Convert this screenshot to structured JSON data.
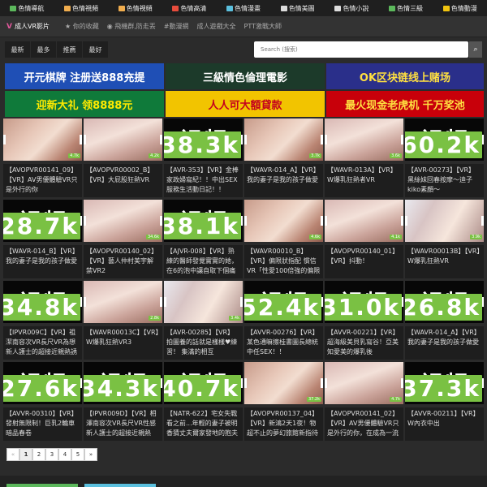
{
  "topnav": [
    {
      "label": "色情導航",
      "icon": "green-square-icon",
      "color": "#5cb85c"
    },
    {
      "label": "色情視頻",
      "icon": "orange-circle-icon",
      "color": "#f0ad4e"
    },
    {
      "label": "色情視頻",
      "icon": "orange-circle-icon",
      "color": "#f0ad4e"
    },
    {
      "label": "色情高清",
      "icon": "red-heart-icon",
      "color": "#e74c3c"
    },
    {
      "label": "色情漫畫",
      "icon": "blue-image-icon",
      "color": "#5bc0de"
    },
    {
      "label": "色情美圖",
      "icon": "picture-icon",
      "color": "#dddddd"
    },
    {
      "label": "色情小說",
      "icon": "book-icon",
      "color": "#dddddd"
    },
    {
      "label": "色情三級",
      "icon": "green-square-icon",
      "color": "#5cb85c"
    },
    {
      "label": "色情動漫",
      "icon": "yellow-circle-icon",
      "color": "#f1c40f"
    }
  ],
  "header": {
    "logo": "成人VR影片",
    "links": [
      "你的收藏",
      "飛機群,防走丟",
      "#動漫網",
      "成人遊戲大全",
      "PTT激戰大師"
    ]
  },
  "subnav": {
    "tabs": [
      "最新",
      "最多",
      "推薦",
      "最好"
    ],
    "search_placeholder": "Search (搜索)"
  },
  "banners": [
    {
      "text": "开元棋牌 注册送888充提",
      "bg": "#1f4fb5",
      "fg": "#ffffff"
    },
    {
      "text": "三級情色倫理電影",
      "bg": "#1c3a2a",
      "fg": "#ffffff"
    },
    {
      "text": "OK区块链线上赌场",
      "bg": "#2a2f8a",
      "fg": "#ffe040"
    },
    {
      "text": "迎新大礼 领8888元",
      "bg": "#0f7a3a",
      "fg": "#ffea00"
    },
    {
      "text": "人人可大額貸款",
      "bg": "#f2c400",
      "fg": "#c4001d"
    },
    {
      "text": "最火现金老虎机 千万奖池",
      "bg": "#c8000a",
      "fg": "#ffe040"
    }
  ],
  "cards": [
    {
      "type": "img",
      "badge": "4.7k",
      "title": "【AVOPVR00141_09】【VR】AV男優體驗VR只是外行的你"
    },
    {
      "type": "img",
      "badge": "4.2k",
      "title": "【AVOPVR00002_B】【VR】大屁股狂熱VR"
    },
    {
      "type": "video",
      "badge": "38.3k",
      "title": "【AVR-353】【VR】金棒家政婦寫紀！！中出SEX服務生活動日記！！"
    },
    {
      "type": "img",
      "badge": "3.7k",
      "title": "【WAVR-014_A】【VR】我的妻子是我的孩子做愛"
    },
    {
      "type": "img",
      "badge": "3.6k",
      "title": "【WAVR-013A】【VR】W爆乳狂熱者VR"
    },
    {
      "type": "video",
      "badge": "60.2k",
      "title": "【AVR-00273】【VR】黑絲妹回春按摩～迪子kiko素顏～"
    },
    {
      "type": "video",
      "badge": "28.7k",
      "title": "【WAVR-014_B】【VR】我的妻子是我的孩子做愛"
    },
    {
      "type": "img",
      "badge": "34.6k",
      "title": "【AVOPVR00140_02】【VR】藝人仲村美宇解禁VR2"
    },
    {
      "type": "video",
      "badge": "38.1k",
      "title": "【AJVR-008】【VR】熟練的醫師發覺實實的她，在6的泡中讓自取下個痛"
    },
    {
      "type": "img",
      "badge": "4.6k",
      "title": "【WAVR00010_B】【VR】偏限狀指配 慣信VR「性愛100倍強的偏限"
    },
    {
      "type": "img",
      "badge": "4.1k",
      "title": "【AVOPVR00140_01】【VR】抖動！"
    },
    {
      "type": "img",
      "badge": "3.9k",
      "title": "【WAVR00013B】【VR】W爆乳狂熱VR"
    },
    {
      "type": "video",
      "badge": "34.8k",
      "title": "【IPVR009C】【VR】祖潔南容次VR長尺VR為想新人護士的超接近親熱誘"
    },
    {
      "type": "img",
      "badge": "2.8k",
      "title": "【WAVR00013C】【VR】W爆乳狂熱VR3"
    },
    {
      "type": "img",
      "badge": "3.4k",
      "title": "【AVR-00285】【VR】拍圖養的話就是樣樣♥練習！ 集滿的相互"
    },
    {
      "type": "video",
      "badge": "52.4k",
      "title": "【AVVR-00276】【VR】某色通嘛擦桂書圖長總統中任SEX！！"
    },
    {
      "type": "video",
      "badge": "31.0k",
      "title": "【AVVR-00221】【VR】超海級美貝乳寫谷！亞美知愛美的爆乳後"
    },
    {
      "type": "video",
      "badge": "26.8k",
      "title": "【WAVR-014_A】【VR】我的妻子是我的孩子做愛"
    },
    {
      "type": "video",
      "badge": "27.6k",
      "title": "【AVVR-00310】【VR】發射無限制！巨乳2輪車暗品春卷"
    },
    {
      "type": "video",
      "badge": "34.3k",
      "title": "【IPVR009D】【VR】相澤南容次VR長尺VR性感新人護士的超接近親熱"
    },
    {
      "type": "video",
      "badge": "40.7k",
      "title": "【NATR-622】宅女失戰看之前...年輕的妻子被明香猜丈夫爾家發地的抱夫"
    },
    {
      "type": "img",
      "badge": "37.2k",
      "title": "【AVOPVR00137_04】【VR】新鴻2天1夜！物超不止的夢幻旅館新指待"
    },
    {
      "type": "img",
      "badge": "4.7k",
      "title": "【AVOPVR00141_02】【VR】AV男優體驗VR只是外行的你，在成為一流"
    },
    {
      "type": "video",
      "badge": "37.3k",
      "title": "【AVVR-00211】【VR】W內衣中出"
    }
  ],
  "pagination": [
    "«",
    "1",
    "2",
    "3",
    "4",
    "5",
    "»"
  ],
  "footer": {
    "left_color": "#5cb85c",
    "right_color": "#5bc0de"
  }
}
